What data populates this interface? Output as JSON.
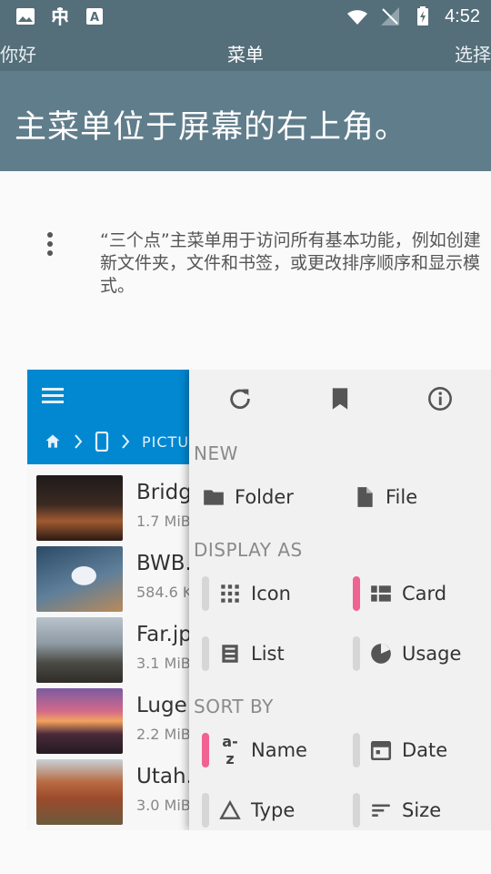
{
  "status_bar": {
    "time": "4:52"
  },
  "top_nav": {
    "left": "你好",
    "title": "菜单",
    "right": "选择"
  },
  "hero": {
    "title": "主菜单位于屏幕的右上角。"
  },
  "description": "“三个点”主菜单用于访问所有基本功能，例如创建新文件夹，文件和书签，或更改排序顺序和显示模式。",
  "screenshot": {
    "breadcrumb_text": "PICTU",
    "files": [
      {
        "name": "Bridg",
        "size": "1.7 MiB"
      },
      {
        "name": "BWB.",
        "size": "584.6 K"
      },
      {
        "name": "Far.jp",
        "size": "3.1 MiB"
      },
      {
        "name": "Luge",
        "size": "2.2 MiB"
      },
      {
        "name": "Utah.",
        "size": "3.0 MiB"
      }
    ],
    "menu": {
      "new_header": "NEW",
      "folder": "Folder",
      "file": "File",
      "display_header": "DISPLAY AS",
      "icon": "Icon",
      "card": "Card",
      "list": "List",
      "usage": "Usage",
      "sort_header": "SORT BY",
      "name": "Name",
      "date": "Date",
      "type": "Type",
      "size": "Size",
      "az_glyph": "a-z"
    },
    "accent": "#f06292"
  }
}
